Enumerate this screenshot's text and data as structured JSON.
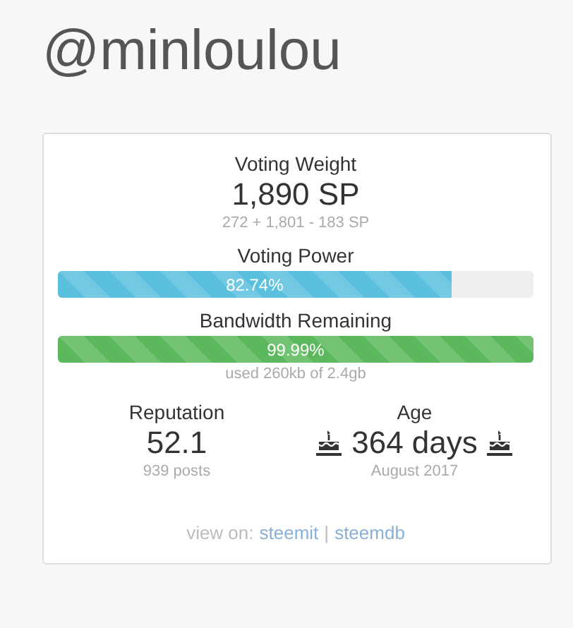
{
  "username": "@minloulou",
  "weight": {
    "label": "Voting Weight",
    "value": "1,890 SP",
    "detail": "272 + 1,801 - 183 SP"
  },
  "bars": [
    {
      "label": "Voting Power",
      "kind": "info",
      "level": 0.8274,
      "reading": "82.74%"
    },
    {
      "label": "Bandwidth Remaining",
      "kind": "success",
      "level": 0.9999,
      "reading": "99.99%",
      "note": "used 260kb of 2.4gb"
    }
  ],
  "stats": [
    {
      "label": "Reputation",
      "value": "52.1",
      "detail": "939 posts",
      "cake": false
    },
    {
      "label": "Age",
      "value": "364 days",
      "detail": "August 2017",
      "cake": true
    }
  ],
  "footer": {
    "prefix": "view on:",
    "links": [
      "steemit",
      "steemdb"
    ],
    "separator": "|"
  }
}
